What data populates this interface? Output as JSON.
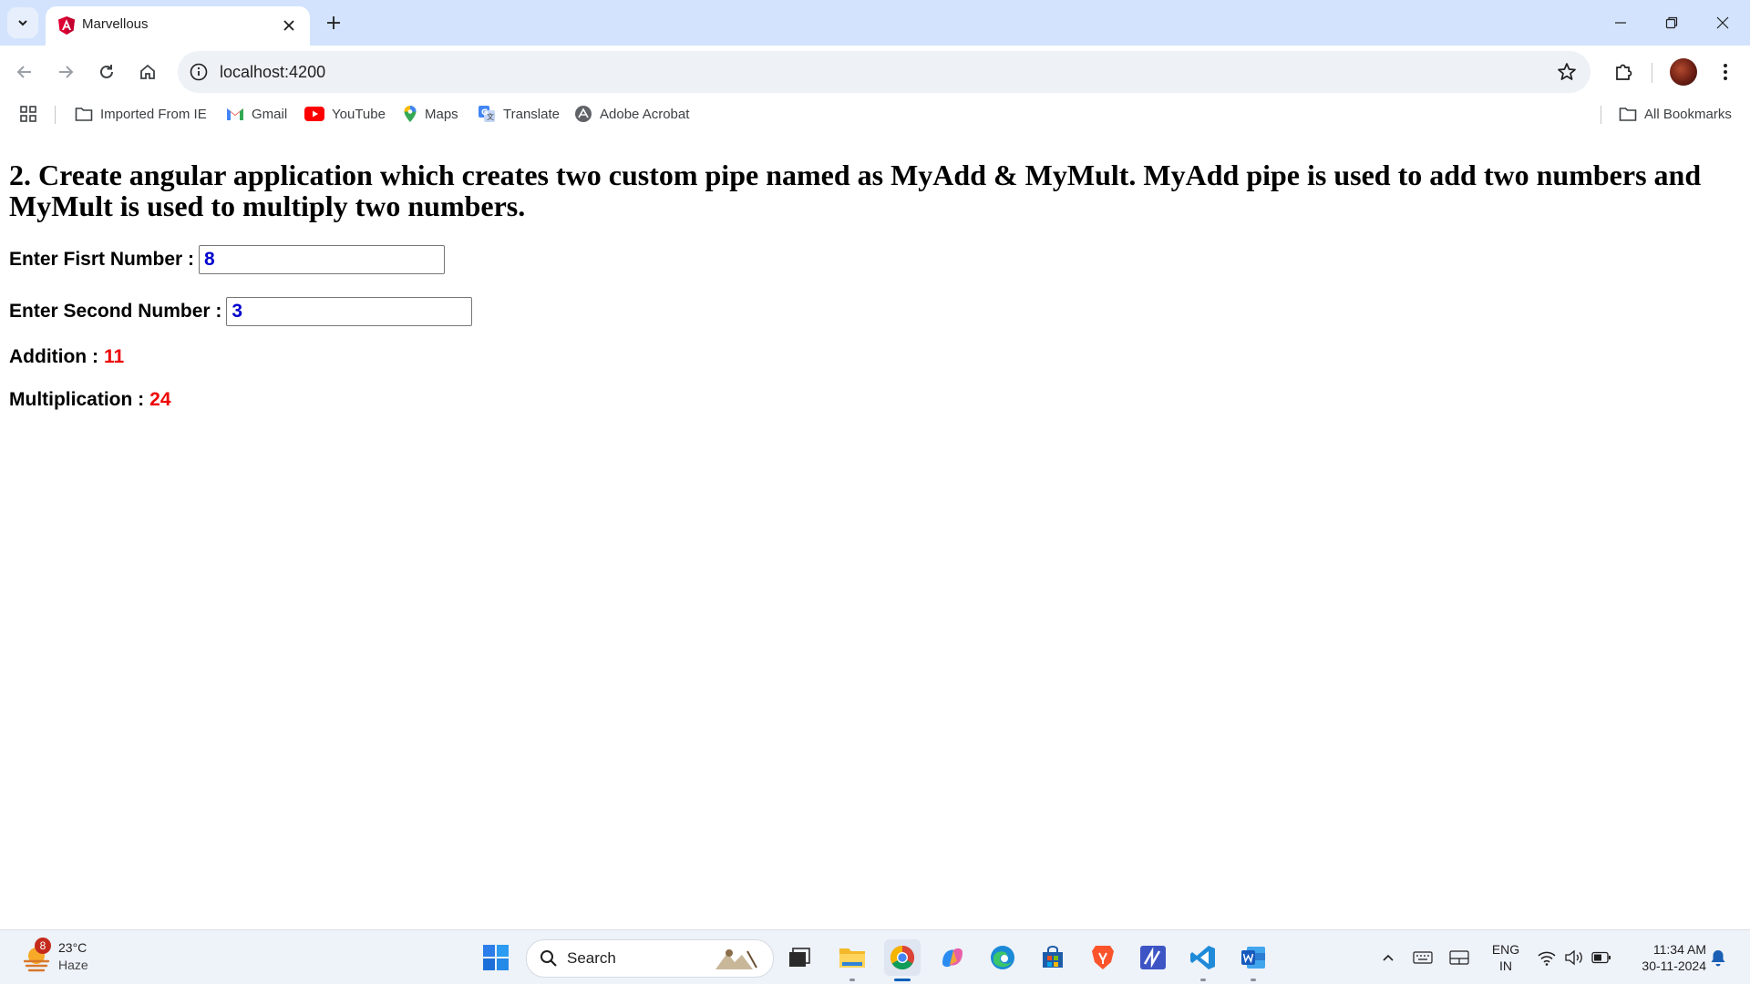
{
  "browser": {
    "tab_title": "Marvellous",
    "url": "localhost:4200",
    "bookmarks": [
      {
        "label": "Imported From IE",
        "icon": "folder-icon"
      },
      {
        "label": "Gmail",
        "icon": "gmail-icon"
      },
      {
        "label": "YouTube",
        "icon": "youtube-icon"
      },
      {
        "label": "Maps",
        "icon": "maps-icon"
      },
      {
        "label": "Translate",
        "icon": "translate-icon"
      },
      {
        "label": "Adobe Acrobat",
        "icon": "acrobat-icon"
      }
    ],
    "all_bookmarks": "All Bookmarks"
  },
  "page": {
    "heading": "2. Create angular application which creates two custom pipe named as MyAdd & MyMult. MyAdd pipe is used to add two numbers and MyMult is used to multiply two numbers.",
    "first_label": "Enter Fisrt Number :",
    "first_value": "8",
    "second_label": "Enter Second Number :",
    "second_value": "3",
    "addition_label": "Addition :",
    "addition_value": "11",
    "multiplication_label": "Multiplication :",
    "multiplication_value": "24"
  },
  "taskbar": {
    "weather_badge": "8",
    "temperature": "23°C",
    "condition": "Haze",
    "search_label": "Search",
    "lang_line1": "ENG",
    "lang_line2": "IN",
    "time": "11:34 AM",
    "date": "30-11-2024"
  },
  "colors": {
    "tabstrip": "#d3e3fd",
    "input_text": "#0000cc",
    "result_text": "#ee0000"
  }
}
